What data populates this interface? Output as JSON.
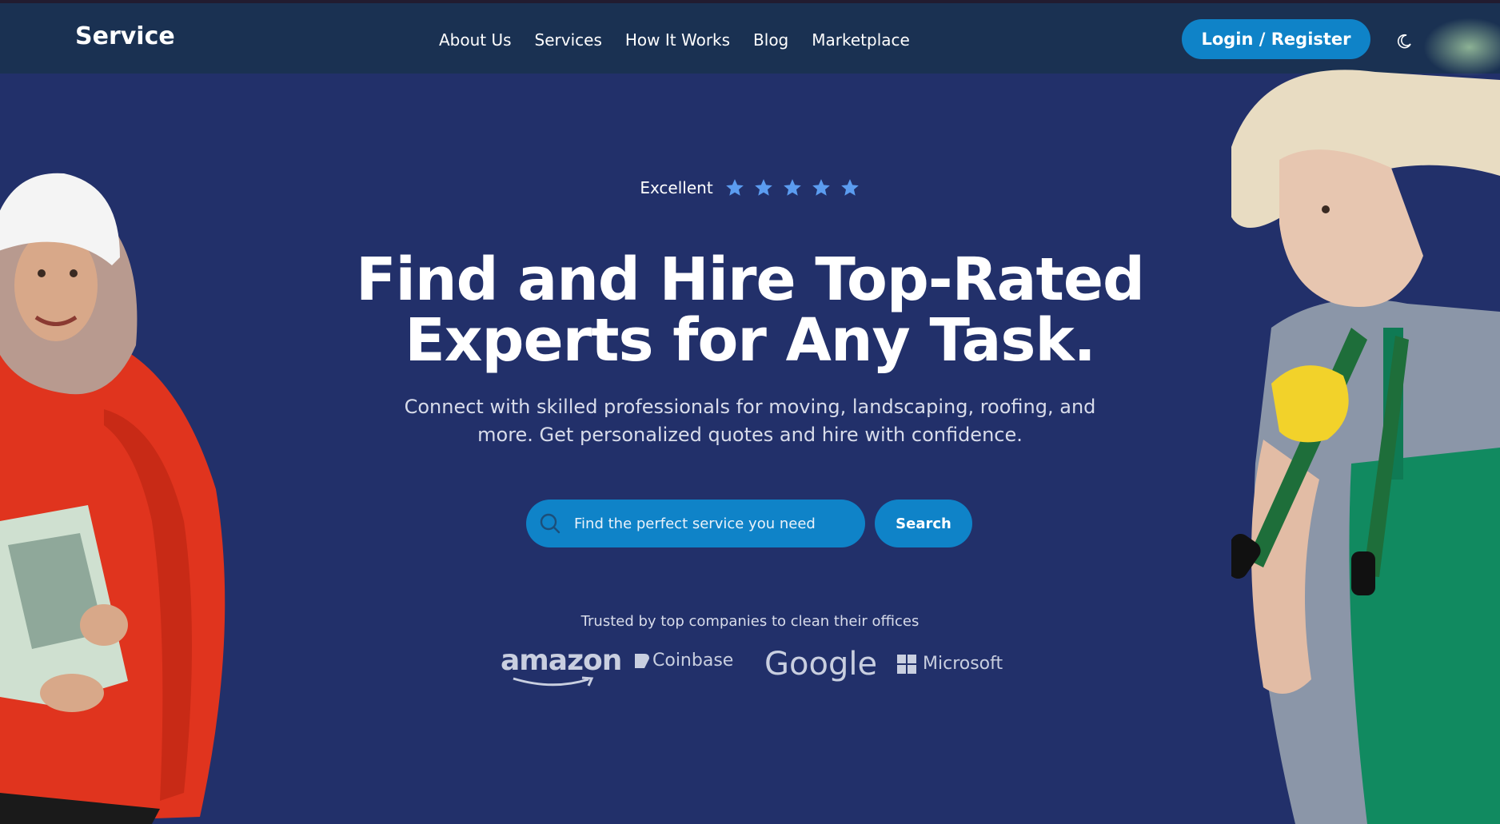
{
  "nav": {
    "brand": "Service",
    "links": [
      "About Us",
      "Services",
      "How It Works",
      "Blog",
      "Marketplace"
    ],
    "login_label": "Login / Register",
    "theme_icon": "moon-icon"
  },
  "hero": {
    "rating_label": "Excellent",
    "rating_stars": 5,
    "title_line1": "Find and Hire Top-Rated",
    "title_line2": "Experts for Any Task.",
    "subtitle_line1": "Connect with skilled professionals for moving, landscaping, roofing, and",
    "subtitle_line2": "more. Get personalized quotes and hire with confidence.",
    "search": {
      "placeholder": "Find the perfect service you need",
      "button_label": "Search"
    },
    "trusted_text": "Trusted by top companies to clean their offices",
    "logos": [
      "amazon",
      "Coinbase",
      "Google",
      "Microsoft"
    ]
  },
  "colors": {
    "page_bg": "#22306a",
    "nav_bg": "#1a3152",
    "accent": "#0f83c8",
    "star": "#5b9cf0"
  }
}
